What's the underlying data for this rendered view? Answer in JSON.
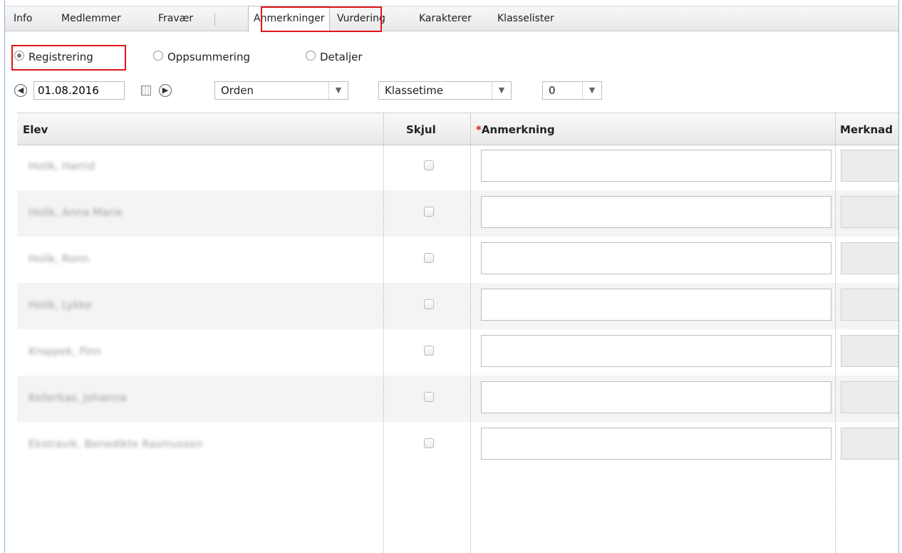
{
  "tabs": [
    "Info",
    "Medlemmer",
    "Fravær",
    "Anmerkninger",
    "Vurdering",
    "Karakterer",
    "Klasselister"
  ],
  "active_tab": "Anmerkninger",
  "view_options": {
    "registrering": "Registrering",
    "oppsummering": "Oppsummering",
    "detaljer": "Detaljer",
    "selected": "Registrering"
  },
  "controls": {
    "date": "01.08.2016",
    "category": "Orden",
    "lesson": "Klassetime",
    "count": "0"
  },
  "grid": {
    "headers": {
      "elev": "Elev",
      "skjul": "Skjul",
      "anmerkning_required": "*",
      "anmerkning": "Anmerkning",
      "merknad": "Merknad"
    },
    "rows": [
      {
        "name": "Holik, Harrid"
      },
      {
        "name": "Holik, Anna Marie"
      },
      {
        "name": "Holik, Ronn"
      },
      {
        "name": "Holik, Lykke"
      },
      {
        "name": "Kroppek, Finn"
      },
      {
        "name": "Kellerkas, Johanna"
      },
      {
        "name": "Ekstravik, Benedikte Rasmussen"
      }
    ]
  },
  "colors": {
    "highlight": "#e0161b",
    "frame": "#8bb3d6"
  }
}
